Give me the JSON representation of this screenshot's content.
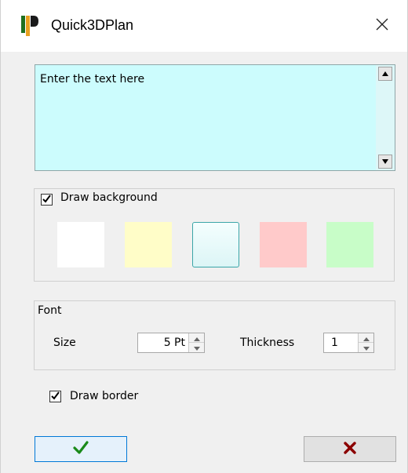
{
  "window": {
    "title": "Quick3DPlan",
    "icon": "quick3dplan-logo-icon",
    "close_icon": "close-icon"
  },
  "text_area": {
    "value": "Enter the text here",
    "background_color": "#ccfcfd"
  },
  "background": {
    "checkbox_label": "Draw background",
    "checked": true,
    "swatches": [
      {
        "name": "white",
        "color": "#ffffff",
        "selected": false
      },
      {
        "name": "light-yellow",
        "color": "#fffdc8",
        "selected": false
      },
      {
        "name": "light-cyan",
        "color": "#ddf7f8",
        "selected": true
      },
      {
        "name": "light-red",
        "color": "#ffcaca",
        "selected": false
      },
      {
        "name": "light-green",
        "color": "#c8fdc8",
        "selected": false
      }
    ]
  },
  "font": {
    "group_label": "Font",
    "size_label": "Size",
    "size_value": "5 Pt",
    "thickness_label": "Thickness",
    "thickness_value": "1"
  },
  "border": {
    "checkbox_label": "Draw border",
    "checked": true
  },
  "buttons": {
    "ok_icon": "checkmark-icon",
    "ok_color": "#1a8a1a",
    "cancel_icon": "x-icon",
    "cancel_color": "#8b0000"
  }
}
